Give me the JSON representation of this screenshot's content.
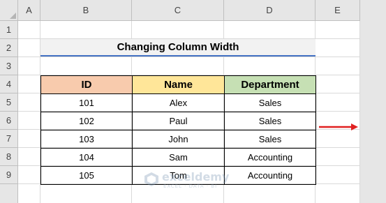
{
  "column_headers": [
    "A",
    "B",
    "C",
    "D",
    "E"
  ],
  "row_headers": [
    "1",
    "2",
    "3",
    "4",
    "5",
    "6",
    "7",
    "8",
    "9"
  ],
  "title": "Changing Column Width",
  "table": {
    "headers": [
      "ID",
      "Name",
      "Department"
    ],
    "header_colors": [
      "#f8cbad",
      "#ffe699",
      "#c6e0b4"
    ],
    "rows": [
      [
        "101",
        "Alex",
        "Sales"
      ],
      [
        "102",
        "Paul",
        "Sales"
      ],
      [
        "103",
        "John",
        "Sales"
      ],
      [
        "104",
        "Sam",
        "Accounting"
      ],
      [
        "105",
        "Tom",
        "Accounting"
      ]
    ]
  },
  "watermark": {
    "name": "exceldemy",
    "tagline": "EXCEL · DATA · BI"
  },
  "colors": {
    "title_underline": "#4472c4",
    "arrow": "#e02020",
    "header_bg": "#e6e6e6"
  },
  "icons": {
    "arrow": "right-arrow-icon",
    "logo": "exceldemy-logo-icon"
  }
}
